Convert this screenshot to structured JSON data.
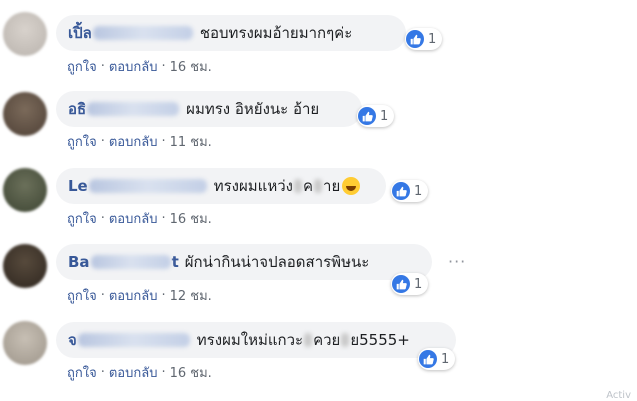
{
  "comments": [
    {
      "author_visible": "เปิ้ล",
      "message": "ชอบทรงผมอ้ายมากๆค่ะ",
      "reaction_count": "1",
      "like_label": "ถูกใจ",
      "reply_label": "ตอบกลับ",
      "time": "16 ชม."
    },
    {
      "author_visible": "อธิ",
      "message": "ผมทรง อิหยังนะ อ้าย",
      "reaction_count": "1",
      "like_label": "ถูกใจ",
      "reply_label": "ตอบกลับ",
      "time": "11 ชม."
    },
    {
      "author_visible": "Le",
      "message_part1": "ทรงผมแหว่ง",
      "message_part2": "ค",
      "message_part3": "าย",
      "reaction_count": "1",
      "like_label": "ถูกใจ",
      "reply_label": "ตอบกลับ",
      "time": "16 ชม."
    },
    {
      "author_visible_start": "Ba",
      "author_visible_end": "t",
      "message": "ผักน่ากินน่าจปลอดสารพิษนะ",
      "reaction_count": "1",
      "like_label": "ถูกใจ",
      "reply_label": "ตอบกลับ",
      "time": "12 ชม.",
      "more_label": "···"
    },
    {
      "author_visible": "จ",
      "message_part1": "ทรงผมใหม่แกวะ",
      "message_part2": "ควย",
      "message_part3": "ย5555+",
      "reaction_count": "1",
      "like_label": "ถูกใจ",
      "reply_label": "ตอบกลับ",
      "time": "16 ชม."
    }
  ],
  "colors": {
    "bubble": "#f2f3f5",
    "author": "#385898",
    "link": "#385898",
    "meta": "#606770",
    "like_blue": "#3578e5"
  },
  "icons": {
    "like": "thumbs-up-icon",
    "emoji": "laughing-emoji-icon",
    "more": "more-options-icon"
  },
  "footer_fragment": "Activ"
}
